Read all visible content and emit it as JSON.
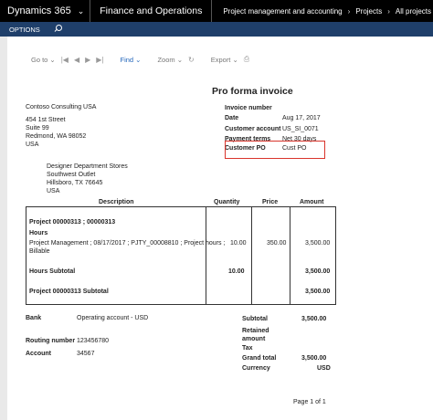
{
  "nav": {
    "app_name": "Dynamics 365",
    "module": "Finance and Operations",
    "breadcrumbs": [
      "Project management and accounting",
      "Projects",
      "All projects"
    ]
  },
  "options": {
    "label": "OPTIONS"
  },
  "toolbar": {
    "goto": "Go to",
    "find": "Find",
    "zoom": "Zoom",
    "export": "Export"
  },
  "invoice": {
    "title": "Pro forma invoice",
    "company": "Contoso Consulting USA",
    "company_address": [
      "454 1st Street",
      "Suite 99",
      "Redmond, WA 98052",
      "USA"
    ],
    "customer_address": [
      "Designer Department Stores",
      "Southwest Outlet",
      "Hillsboro, TX 76645",
      "USA"
    ],
    "fields": [
      {
        "label": "Invoice number",
        "value": ""
      },
      {
        "label": "Date",
        "value": "Aug 17, 2017"
      },
      {
        "label": "Customer account",
        "value": "US_SI_0071"
      },
      {
        "label": "Payment terms",
        "value": "Net 30 days"
      },
      {
        "label": "Customer PO",
        "value": "Cust PO"
      }
    ],
    "columns": [
      "Description",
      "Quantity",
      "Price",
      "Amount"
    ],
    "project_header": "Project 00000313 ; 00000313",
    "group": "Hours",
    "line": {
      "description_1": "Project Management ; 08/17/2017 ; PJTY_00008810 ; Project hours ;",
      "description_2": "Billable",
      "quantity": "10.00",
      "price": "350.00",
      "amount": "3,500.00"
    },
    "hours_subtotal": {
      "label": "Hours Subtotal",
      "quantity": "10.00",
      "amount": "3,500.00"
    },
    "project_subtotal": {
      "label": "Project 00000313 Subtotal",
      "amount": "3,500.00"
    },
    "bank": {
      "label": "Bank",
      "value": "Operating account - USD"
    },
    "routing": {
      "label": "Routing number",
      "value": "123456780"
    },
    "account": {
      "label": "Account",
      "value": "34567"
    },
    "totals": [
      {
        "label": "Subtotal",
        "value": "3,500.00"
      },
      {
        "label": "Retained amount",
        "value": ""
      },
      {
        "label": "Tax",
        "value": ""
      },
      {
        "label": "Grand total",
        "value": "3,500.00"
      },
      {
        "label": "Currency",
        "value": "USD"
      }
    ],
    "page": "Page 1 of 1"
  }
}
